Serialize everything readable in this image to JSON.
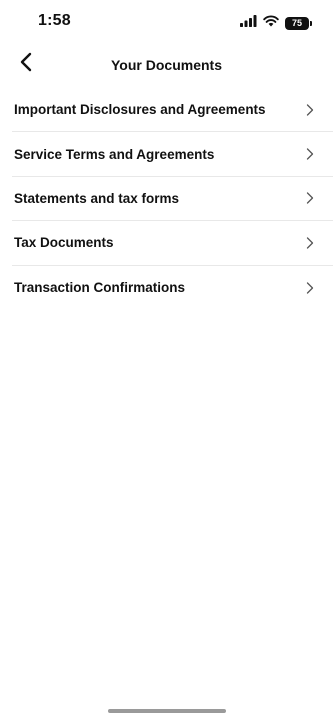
{
  "status_bar": {
    "time": "1:58",
    "battery_level": "75",
    "icons": [
      "cellular-signal-icon",
      "wifi-icon",
      "battery-icon"
    ]
  },
  "header": {
    "title": "Your Documents",
    "back_icon": "chevron-left-icon"
  },
  "documents": [
    {
      "label": "Important Disclosures and Agreements"
    },
    {
      "label": "Service Terms and Agreements"
    },
    {
      "label": "Statements and tax forms"
    },
    {
      "label": "Tax Documents"
    },
    {
      "label": "Transaction Confirmations"
    }
  ],
  "colors": {
    "text": "#111111",
    "divider": "#e8e8e8",
    "chevron": "#555555",
    "background": "#ffffff",
    "home_indicator": "#9a9a9a"
  }
}
